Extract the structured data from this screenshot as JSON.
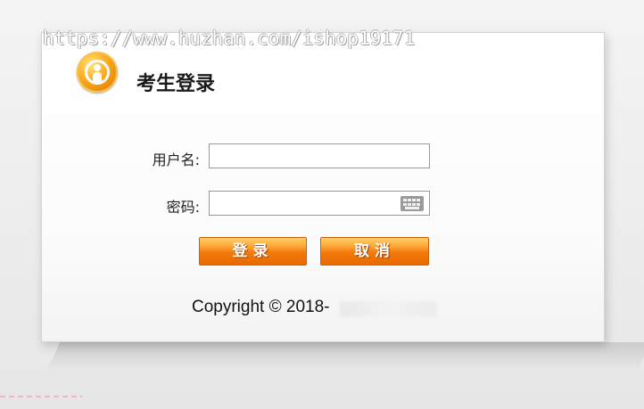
{
  "watermark": "https://www.huzhan.com/ishop19171",
  "login": {
    "title": "考生登录",
    "username_label": "用户名:",
    "username_value": "",
    "password_label": "密码:",
    "password_value": "",
    "submit_label": "登录",
    "cancel_label": "取消"
  },
  "footer": {
    "copyright": "Copyright © 2018-"
  },
  "icons": {
    "logo": "person-badge-icon",
    "keyboard": "keyboard-icon"
  },
  "colors": {
    "button_orange": "#f2790a",
    "logo_orange": "#f9a81a"
  }
}
